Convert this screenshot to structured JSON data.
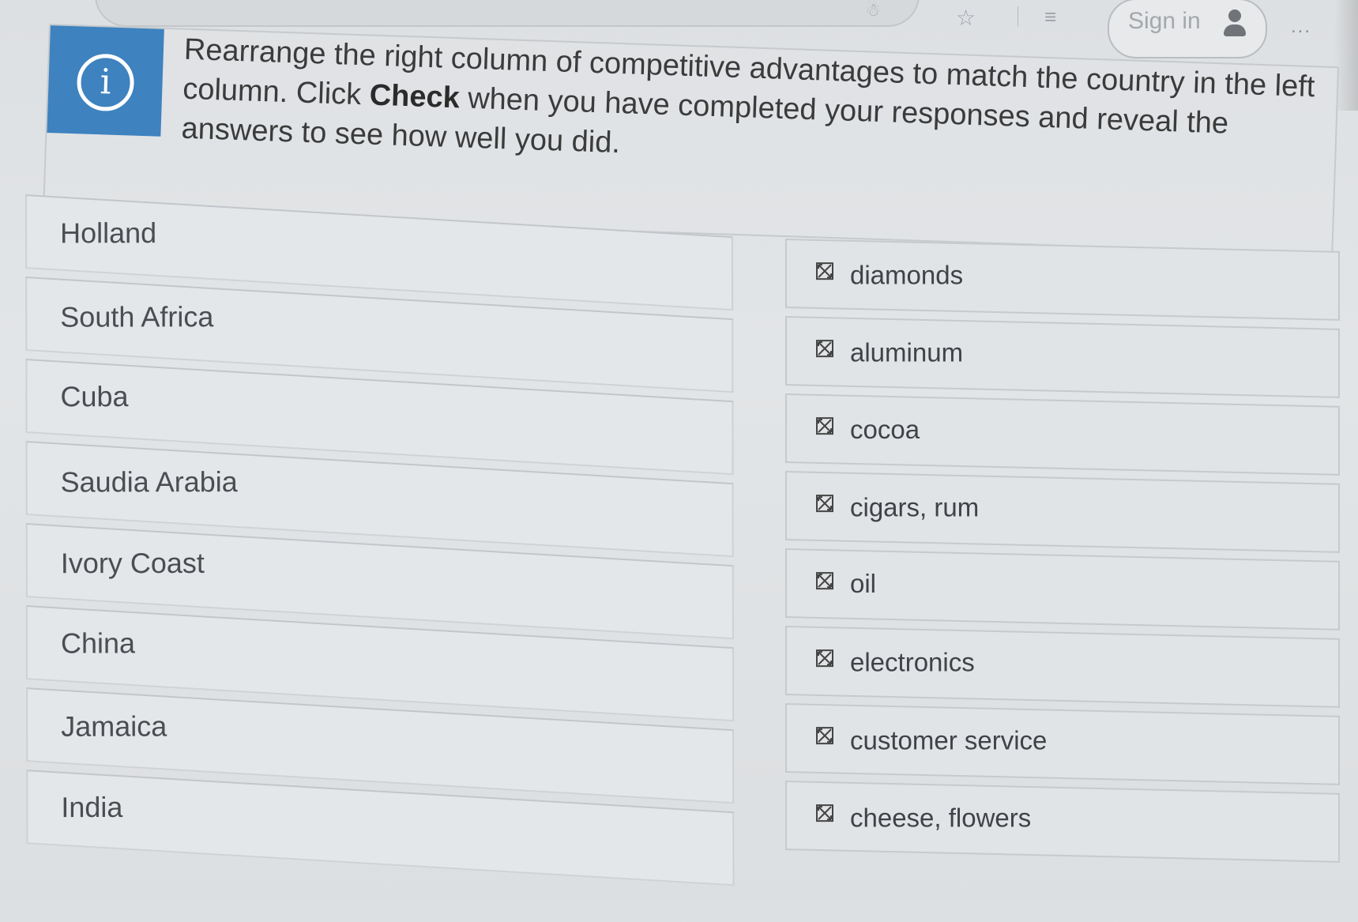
{
  "toolbar": {
    "signin_label": "Sign in",
    "more_label": "...",
    "favorites_icon": "favorites-icon",
    "collections_icon": "collections-icon",
    "avatar_icon": "avatar-icon"
  },
  "instruction": {
    "icon": "info-icon",
    "text_before": "Rearrange the right column of competitive advantages to match the country in the left column. Click ",
    "bold_word": "Check",
    "text_after": " when you have completed your responses and reveal the answers to see how well you did.",
    "accent_color": "#3e82bf"
  },
  "countries": [
    "Holland",
    "South Africa",
    "Cuba",
    "Saudia Arabia",
    "Ivory Coast",
    "China",
    "Jamaica",
    "India"
  ],
  "answers": [
    "diamonds",
    "aluminum",
    "cocoa",
    "cigars, rum",
    "oil",
    "electronics",
    "customer service",
    "cheese, flowers"
  ],
  "answer_icon": "drag-handle-icon"
}
